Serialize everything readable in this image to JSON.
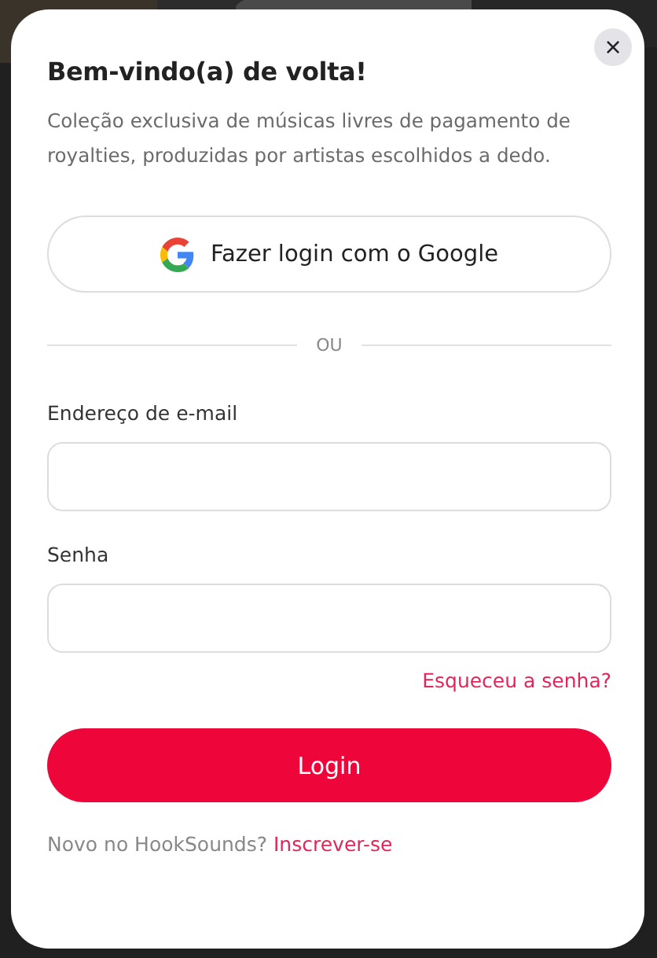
{
  "dialog": {
    "close": "×",
    "title": "Bem-vindo(a) de volta!",
    "description": "Coleção exclusiva de músicas livres de pagamento de royalties, produzidas por artistas escolhidos a dedo.",
    "google_button": "Fazer login com o Google",
    "divider": "OU",
    "fields": [
      {
        "label": "Endereço de e-mail"
      },
      {
        "label": "Senha"
      }
    ],
    "forgot_link": "Esqueceu a senha?",
    "login_button": "Login",
    "footer": {
      "text": "Novo no HookSounds?",
      "link": "Inscrever-se"
    }
  }
}
